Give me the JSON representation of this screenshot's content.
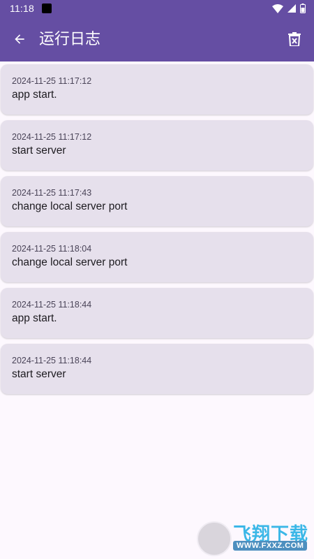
{
  "status_bar": {
    "time": "11:18"
  },
  "appbar": {
    "title": "运行日志"
  },
  "logs": [
    {
      "time": "2024-11-25 11:17:12",
      "message": "app start."
    },
    {
      "time": "2024-11-25 11:17:12",
      "message": "start server"
    },
    {
      "time": "2024-11-25 11:17:43",
      "message": "change local server port"
    },
    {
      "time": "2024-11-25 11:18:04",
      "message": "change local server port"
    },
    {
      "time": "2024-11-25 11:18:44",
      "message": "app start."
    },
    {
      "time": "2024-11-25 11:18:44",
      "message": "start server"
    }
  ],
  "watermark": {
    "brand": "飞翔下载",
    "domain": "WWW.FXXZ.COM"
  },
  "colors": {
    "primary": "#654ea3",
    "card": "#e6e0ec",
    "background": "#fdf8fe"
  }
}
